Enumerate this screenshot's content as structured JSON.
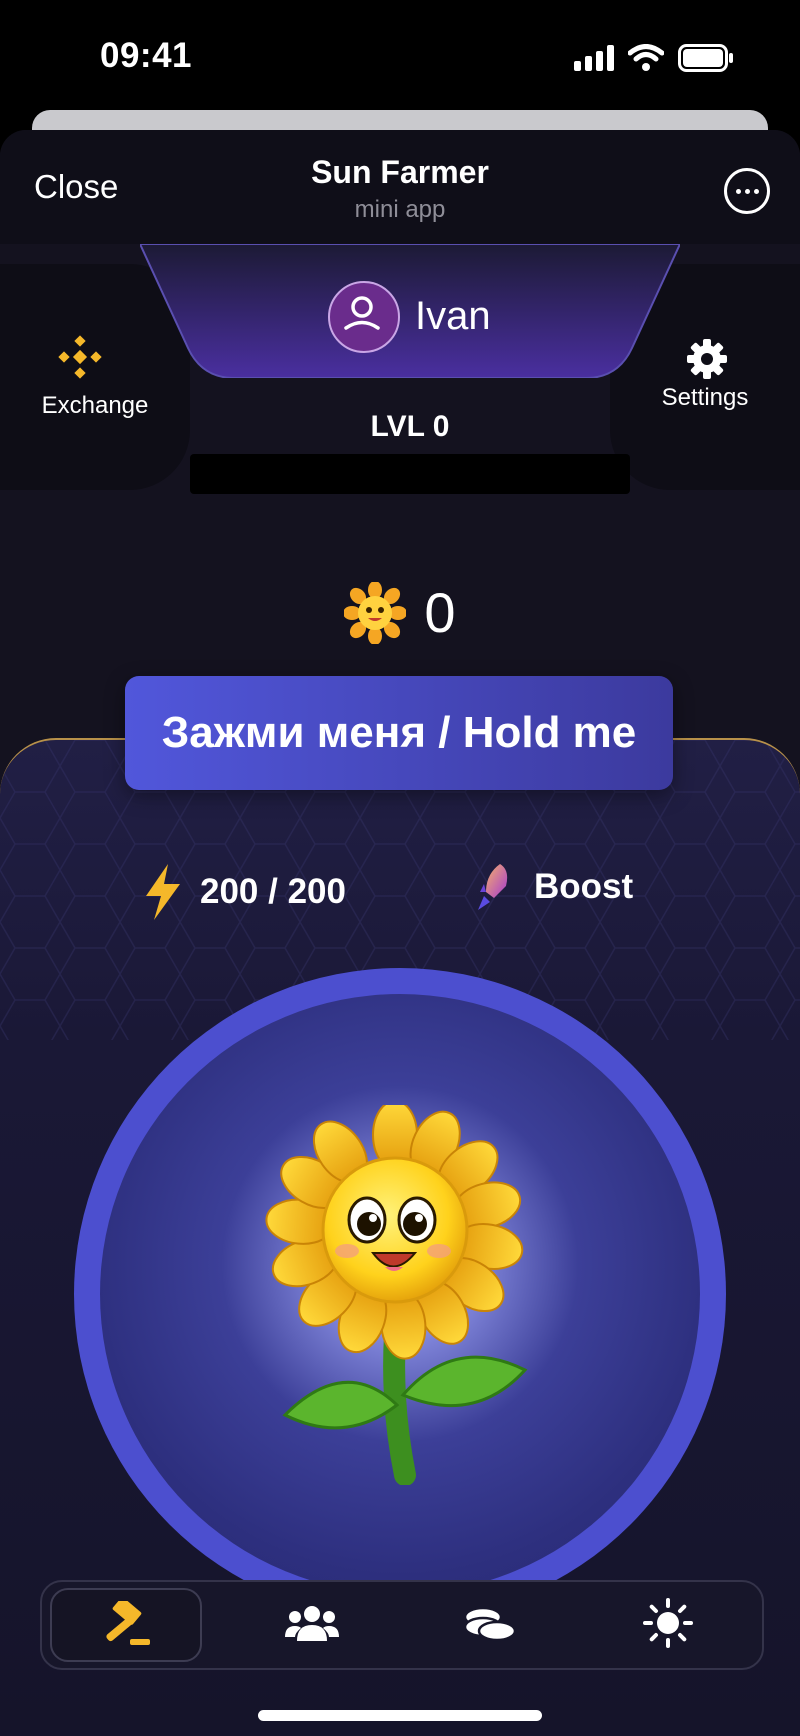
{
  "status": {
    "time": "09:41"
  },
  "topbar": {
    "close_label": "Close",
    "title": "Sun Farmer",
    "subtitle": "mini app"
  },
  "side": {
    "exchange_label": "Exchange",
    "settings_label": "Settings"
  },
  "user": {
    "name": "Ivan",
    "level_label": "LVL 0",
    "level_progress": 0
  },
  "balance": {
    "value": "0"
  },
  "hold_button": {
    "label": "Зажми меня / Hold me"
  },
  "energy": {
    "text": "200 / 200"
  },
  "boost": {
    "label": "Boost"
  },
  "nav": {
    "items": [
      {
        "icon": "hammer-icon",
        "active": true
      },
      {
        "icon": "friends-icon",
        "active": false
      },
      {
        "icon": "coins-icon",
        "active": false
      },
      {
        "icon": "sun-icon",
        "active": false
      }
    ]
  },
  "colors": {
    "accent": "#5157db",
    "gold": "#f5b82a",
    "background": "#14121f"
  }
}
